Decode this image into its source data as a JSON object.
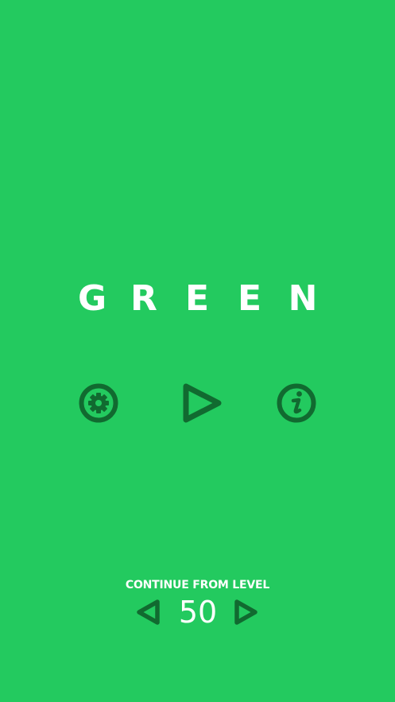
{
  "title": {
    "letters": [
      "G",
      "R",
      "E",
      "E",
      "N"
    ]
  },
  "menu": {
    "settings_icon": "gear-icon",
    "play_icon": "play-triangle-icon",
    "info_icon": "info-icon"
  },
  "level_selector": {
    "label": "CONTINUE FROM LEVEL",
    "level": "50",
    "prev_icon": "triangle-left-icon",
    "next_icon": "triangle-right-icon"
  },
  "colors": {
    "background": "#23ca5f",
    "icon": "#116a30",
    "text": "#ffffff"
  }
}
